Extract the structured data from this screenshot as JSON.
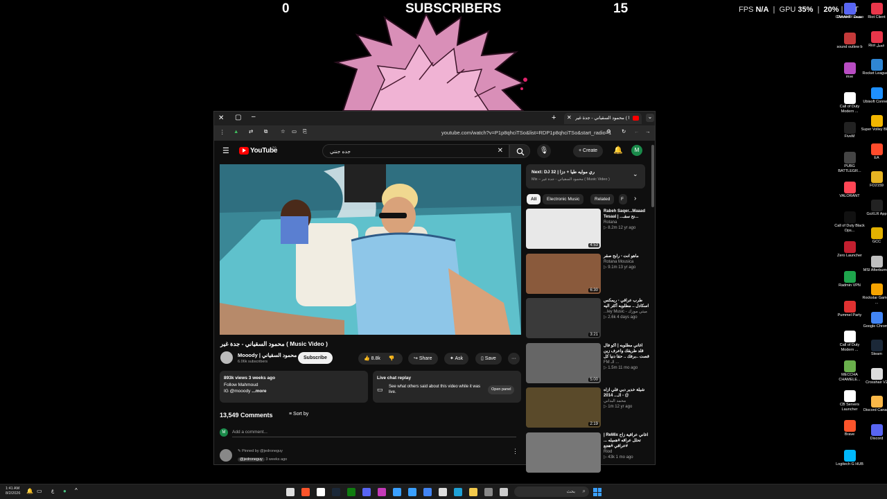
{
  "overlay": {
    "left_count": "0",
    "title": "SUBSCRIBERS",
    "right_count": "15",
    "fps_label": "FPS",
    "fps_value": "N/A",
    "gpu_label": "GPU",
    "gpu_value": "35",
    "gpu_unit": "%",
    "cpu_value": "20",
    "cpu_unit": "%",
    "lat_label": "LAT"
  },
  "desktop_icons": [
    {
      "label": "CAAAHR! Demo",
      "color": "#ffffff"
    },
    {
      "label": "Discord - نسخة",
      "color": "#5865f2"
    },
    {
      "label": "Riot Client",
      "color": "#e8364a"
    },
    {
      "label": "sound outlew b",
      "color": "#c43a3a"
    },
    {
      "label": "Riot عميل",
      "color": "#e8364a"
    },
    {
      "label": "mve",
      "color": "#b84cc2"
    },
    {
      "label": "Rocket League®",
      "color": "#2f86d4"
    },
    {
      "label": "Call of Duty Modern ...",
      "color": "#ffffff"
    },
    {
      "label": "Ubisoft Connect",
      "color": "#1e90ff"
    },
    {
      "label": "FiveM",
      "color": "#222222"
    },
    {
      "label": "Super Volley Blast",
      "color": "#f2b600"
    },
    {
      "label": "PUBG BATTLEGR...",
      "color": "#444444"
    },
    {
      "label": "EA",
      "color": "#ff4b2b"
    },
    {
      "label": "VALORANT",
      "color": "#ff4655"
    },
    {
      "label": "FO2159",
      "color": "#e6b422"
    },
    {
      "label": "Call of Duty Black Ops...",
      "color": "#111111"
    },
    {
      "label": "GoXLR App",
      "color": "#222222"
    },
    {
      "label": "Zero Launcher",
      "color": "#c21f2f"
    },
    {
      "label": "GCC",
      "color": "#e2b100"
    },
    {
      "label": "Radmin VPN",
      "color": "#1ea54c"
    },
    {
      "label": "MSI Afterburner",
      "color": "#bfbfbf"
    },
    {
      "label": "Pummel Party",
      "color": "#e03131"
    },
    {
      "label": "Rockstar Games ...",
      "color": "#f5a300"
    },
    {
      "label": "Call of Duty Modern ...",
      "color": "#ffffff"
    },
    {
      "label": "Google Chrome",
      "color": "#4285f4"
    },
    {
      "label": "MECCHA CHAMELE...",
      "color": "#6ab04c"
    },
    {
      "label": "Steam",
      "color": "#1b2838"
    },
    {
      "label": "CB Servers Launcher",
      "color": "#ffffff"
    },
    {
      "label": "Crosshair V2",
      "color": "#dddddd"
    },
    {
      "label": "Brave",
      "color": "#fb542b"
    },
    {
      "label": "Discord Canary",
      "color": "#fbb848"
    },
    {
      "label": "Logitech G HUB",
      "color": "#00b8fc"
    },
    {
      "label": "Discord",
      "color": "#5865f2"
    }
  ],
  "browser": {
    "tab_title": "محمود السقياني - جدة غير ( Mu",
    "url": "youtube.com/watch?v=P1p8qhciTSo&list=RDP1p8qhciTSo&start_radio=1",
    "yt_logo": "YouTube",
    "yt_region": "SA",
    "search_query": "جده جنتي",
    "create_label": "Create",
    "avatar_letter": "M",
    "video_title": "محمود السقياني - جدة غير ( Music Video )",
    "channel_name": "Mooody | محمود السقياني",
    "subscribers": "6.06k subscribers",
    "subscribe_label": "Subscribe",
    "likes": "8.8k",
    "share_label": "Share",
    "ask_label": "Ask",
    "save_label": "Save",
    "views_line": "893k views  3 weeks ago",
    "desc_line1": "Follow Mahmoud",
    "desc_line2": "IG @mooody",
    "desc_more": "...more",
    "chat_title": "Live chat replay",
    "chat_desc": "See what others said about this video while it was live.",
    "open_panel": "Open panel",
    "comments_count": "13,549 Comments",
    "sort_by": "Sort by",
    "add_comment": "Add a comment...",
    "pinned_by": "Pinned by @jedroneguy",
    "pinned_user": "@jedroneguy",
    "pinned_time": "3 weeks ago",
    "next_label": "Next: DJ 32 | ري موايه طيا + دزا",
    "mix_label": "Mix – محمود السقياني - جدة غير ( Music Video )",
    "chips": [
      "All",
      "Electronic Music",
      "Related",
      "F"
    ]
  },
  "related": [
    {
      "title": "Rabeh Saqer...Maaad Tesaal | ...نح سقـ...",
      "channel": "Rotana",
      "meta": "▷ 8.2m  12 yr ago",
      "dur": "4:53",
      "bg": "#e8e8e8"
    },
    {
      "title": "ماهو انت - رابح صقر",
      "channel": "Rotana Mousica",
      "meta": "▷ 9.1m  13 yr ago",
      "dur": "6:30",
      "bg": "#8a5a3c"
    },
    {
      "title": "طرب عراقي - ريمكس اسكادل .. مطلوبه أكثر اليه",
      "channel": "...ley Music - ميثي موزك",
      "meta": "▷ 2.6k  4 days ago",
      "dur": "3:21",
      "bg": "#3a3a3a"
    },
    {
      "title": "اغاني مطلوبه | اكو فال قلد طريقك واعرف زين قصت ..برفك .. حقا دنيا كل",
      "channel": "FM الـ ...",
      "meta": "▷ 1.5m  11 mo ago",
      "dur": "5:00",
      "bg": "#666666"
    },
    {
      "title": "شيلة خدير دبي فلي ازاه الـ... 2014 - @",
      "channel": "محمد البداني",
      "meta": "▷ 1m  12 yr ago",
      "dur": "2:19",
      "bg": "#5a4a2a"
    },
    {
      "title": "| ReMix اغاني عراقية زاح تحلل عراقه #هميله ... #عراقي #هجع",
      "channel": "Riod",
      "meta": "▷ 43k  1 mo ago",
      "dur": "",
      "bg": "#777777"
    }
  ],
  "taskbar": {
    "time": "1:41 AM",
    "date": "8/2/2026",
    "search_placeholder": "بحث"
  }
}
